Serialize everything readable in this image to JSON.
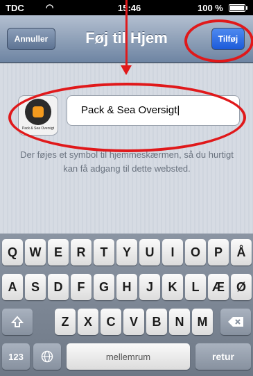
{
  "status_bar": {
    "carrier": "TDC",
    "time": "15:46",
    "battery": "100 %"
  },
  "nav": {
    "cancel_label": "Annuller",
    "title": "Føj til Hjem",
    "add_label": "Tilføj"
  },
  "bookmark": {
    "icon_label": "Pack & Sea Oversigt",
    "name_value": "Pack & Sea Oversigt|"
  },
  "hint_text": "Der føjes et symbol til hjemmeskærmen, så du hurtigt kan få adgang til dette websted.",
  "keyboard": {
    "row1": [
      "Q",
      "W",
      "E",
      "R",
      "T",
      "Y",
      "U",
      "I",
      "O",
      "P",
      "Å"
    ],
    "row2": [
      "A",
      "S",
      "D",
      "F",
      "G",
      "H",
      "J",
      "K",
      "L",
      "Æ",
      "Ø"
    ],
    "row3": [
      "Z",
      "X",
      "C",
      "V",
      "B",
      "N",
      "M"
    ],
    "numbers_label": "123",
    "space_label": "mellemrum",
    "return_label": "retur",
    "shift_icon": "shift-arrow-icon",
    "globe_icon": "globe-icon",
    "delete_icon": "backspace-icon"
  },
  "colors": {
    "annotation": "#e0191b",
    "nav_gradient_top": "#b3bfd0",
    "add_button": "#1c5ad9"
  }
}
